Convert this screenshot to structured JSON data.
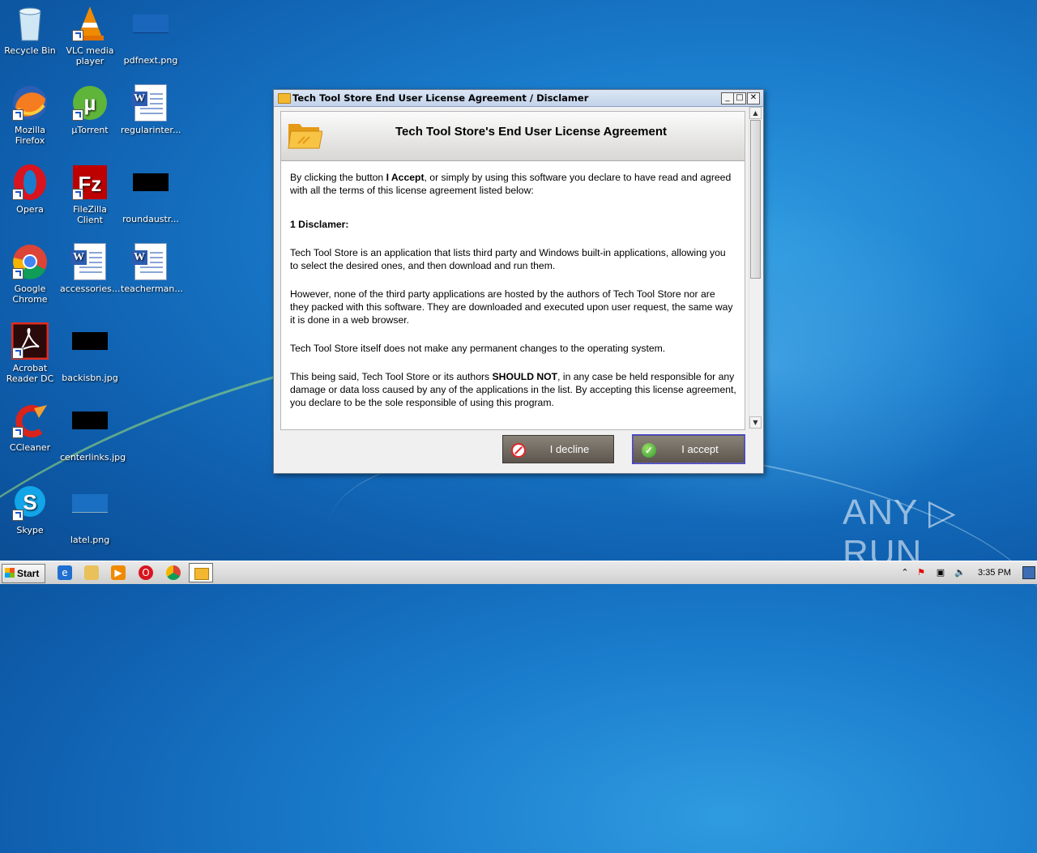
{
  "desktop": {
    "icons": [
      {
        "label": "Recycle Bin"
      },
      {
        "label": "VLC media player"
      },
      {
        "label": "pdfnext.png"
      },
      {
        "label": "Mozilla Firefox"
      },
      {
        "label": "µTorrent"
      },
      {
        "label": "regularinter..."
      },
      {
        "label": "Opera"
      },
      {
        "label": "FileZilla Client"
      },
      {
        "label": "roundaustr..."
      },
      {
        "label": "Google Chrome"
      },
      {
        "label": "accessories..."
      },
      {
        "label": "teacherman..."
      },
      {
        "label": "Acrobat Reader DC"
      },
      {
        "label": "backisbn.jpg"
      },
      {
        "label": "CCleaner"
      },
      {
        "label": "centerlinks.jpg"
      },
      {
        "label": "Skype"
      },
      {
        "label": "latel.png"
      }
    ]
  },
  "window": {
    "title": "Tech Tool Store End User License Agreement / Disclamer",
    "controls": {
      "minimize": "_",
      "maximize": "□",
      "close": "✕"
    },
    "header_title": "Tech Tool Store's End User License Agreement",
    "intro_pre": "By clicking the button ",
    "intro_bold": "I Accept",
    "intro_post": ", or simply by using this software you declare to have read and agreed with all the terms of this license agreement listed below:",
    "section_title": "1 Disclamer:",
    "para1": "Tech Tool Store is an application that lists third party and Windows built-in applications, allowing you to select the desired ones, and then download and run them.",
    "para2": "However, none of the third party applications are hosted by the authors of Tech Tool Store nor are they packed with this software. They are downloaded and executed upon user request, the same way it is done in a web browser.",
    "para3": "Tech Tool Store itself does not make any permanent changes to the operating system.",
    "para4_pre": "This being said, Tech Tool Store or its authors ",
    "para4_bold": "SHOULD NOT",
    "para4_post": ", in any case be held responsible for any damage or data loss caused by any of the applications in the list. By accepting this license agreement, you declare to be the sole responsible of using this program.",
    "decline_label": "I decline",
    "accept_label": "I accept"
  },
  "taskbar": {
    "start_label": "Start",
    "clock": "3:35 PM"
  },
  "watermark": "ANY ▷ RUN"
}
